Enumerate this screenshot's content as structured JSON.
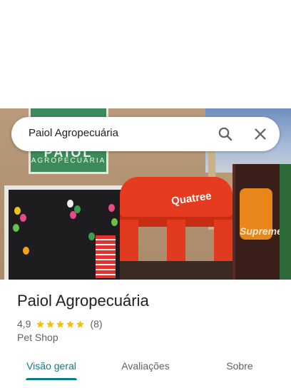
{
  "search": {
    "query": "Paiol Agropecuária",
    "search_icon": "search-icon",
    "close_icon": "close-icon"
  },
  "photo": {
    "sign_text": "AGROPECUÁRIA",
    "sign_big": "PAIOL",
    "tent_brand": "Quatree",
    "banner_brand": "Supreme"
  },
  "place": {
    "name": "Paiol Agropecuária",
    "rating": "4,9",
    "stars": 4.9,
    "review_count": "(8)",
    "category": "Pet Shop"
  },
  "tabs": [
    {
      "label": "Visão geral",
      "active": true
    },
    {
      "label": "Avaliações",
      "active": false
    },
    {
      "label": "Sobre",
      "active": false
    }
  ],
  "colors": {
    "accent": "#0e7c86",
    "star": "#fbbc04",
    "text_primary": "#202124",
    "text_secondary": "#5f6368"
  }
}
